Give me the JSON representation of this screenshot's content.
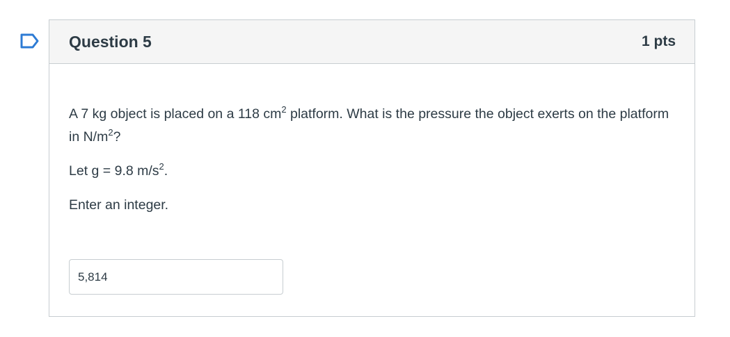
{
  "question": {
    "title": "Question 5",
    "points": "1 pts",
    "text": {
      "line1_a": "A 7 kg object is placed on a 118 cm",
      "line1_sup": "2",
      "line1_b": " platform. What is the pressure the object exerts on the platform in N/m",
      "line1_sup2": "2",
      "line1_c": "?",
      "line2_a": "Let g = 9.8 m/s",
      "line2_sup": "2",
      "line2_b": ".",
      "line3": "Enter an integer."
    },
    "answer_value": "5,814"
  },
  "icons": {
    "flag": "bookmark-flag-icon"
  },
  "colors": {
    "flag_blue": "#2d7bd4",
    "header_bg": "#f5f5f5",
    "border": "#c7cdd1",
    "text": "#2d3b45"
  }
}
